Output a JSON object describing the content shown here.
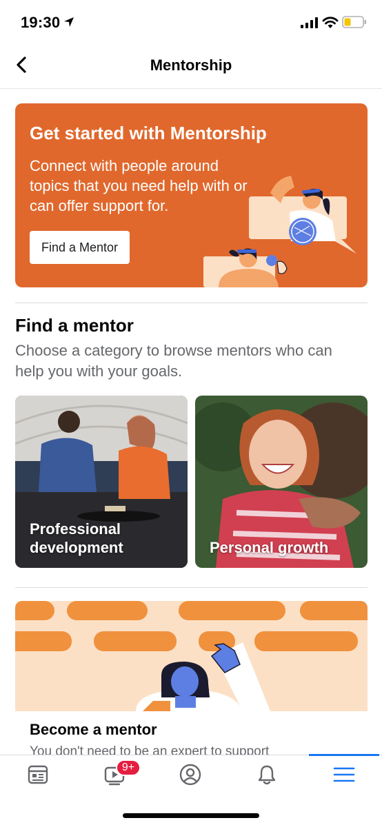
{
  "status_bar": {
    "time": "19:30",
    "icons": [
      "location-arrow-icon",
      "signal-icon",
      "wifi-icon",
      "battery-icon"
    ]
  },
  "nav": {
    "title": "Mentorship",
    "back_icon": "chevron-left-icon"
  },
  "hero": {
    "title": "Get started with Mentorship",
    "description": "Connect with people around topics that you need help with or can offer support for.",
    "button_label": "Find a Mentor",
    "background_color": "#e0682d"
  },
  "find_mentor": {
    "title": "Find a mentor",
    "description": "Choose a category to browse mentors who can help you with your goals.",
    "categories": [
      {
        "label": "Professional development"
      },
      {
        "label": "Personal growth"
      }
    ]
  },
  "become_mentor": {
    "title": "Become a mentor",
    "description": "You don't need to be an expert to support"
  },
  "tab_bar": {
    "tabs": [
      {
        "icon": "news-feed-icon"
      },
      {
        "icon": "watch-video-icon",
        "badge": "9+"
      },
      {
        "icon": "profile-icon"
      },
      {
        "icon": "notifications-bell-icon"
      },
      {
        "icon": "menu-icon",
        "active": true
      }
    ],
    "accent_color": "#1877f2"
  }
}
